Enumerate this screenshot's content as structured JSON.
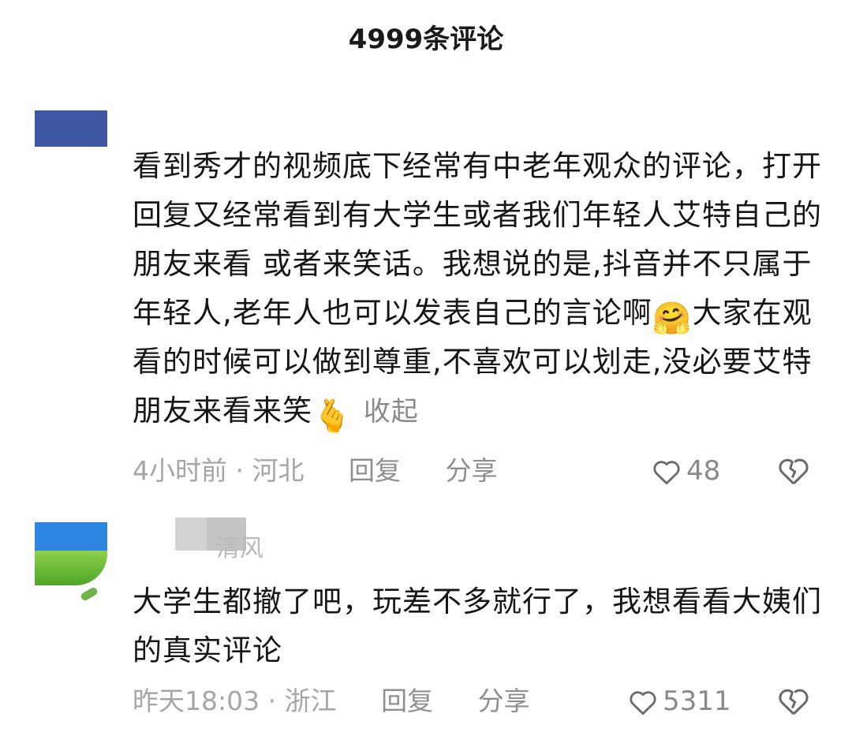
{
  "header": {
    "title": "4999条评论"
  },
  "comments": [
    {
      "text_before_emoji1": "看到秀才的视频底下经常有中老年观众的评论，打开回复又经常看到有大学生或者我们年轻人艾特自己的朋友来看 或者来笑话。我想说的是,抖音并不只属于年轻人,老年人也可以发表自己的言论啊",
      "emoji1": "🤗",
      "text_after_emoji1": "大家在观看的时候可以做到尊重,不喜欢可以划走,没必要艾特朋友来看来笑",
      "emoji2": "🫰",
      "collapse_label": "收起",
      "time": "4小时前",
      "separator": "·",
      "location": "河北",
      "reply_label": "回复",
      "share_label": "分享",
      "likes": "48"
    },
    {
      "username": "清风",
      "text": "大学生都撤了吧，玩差不多就行了，我想看看大姨们的真实评论",
      "time": "昨天18:03",
      "separator": "·",
      "location": "浙江",
      "reply_label": "回复",
      "share_label": "分享",
      "likes": "5311"
    }
  ]
}
